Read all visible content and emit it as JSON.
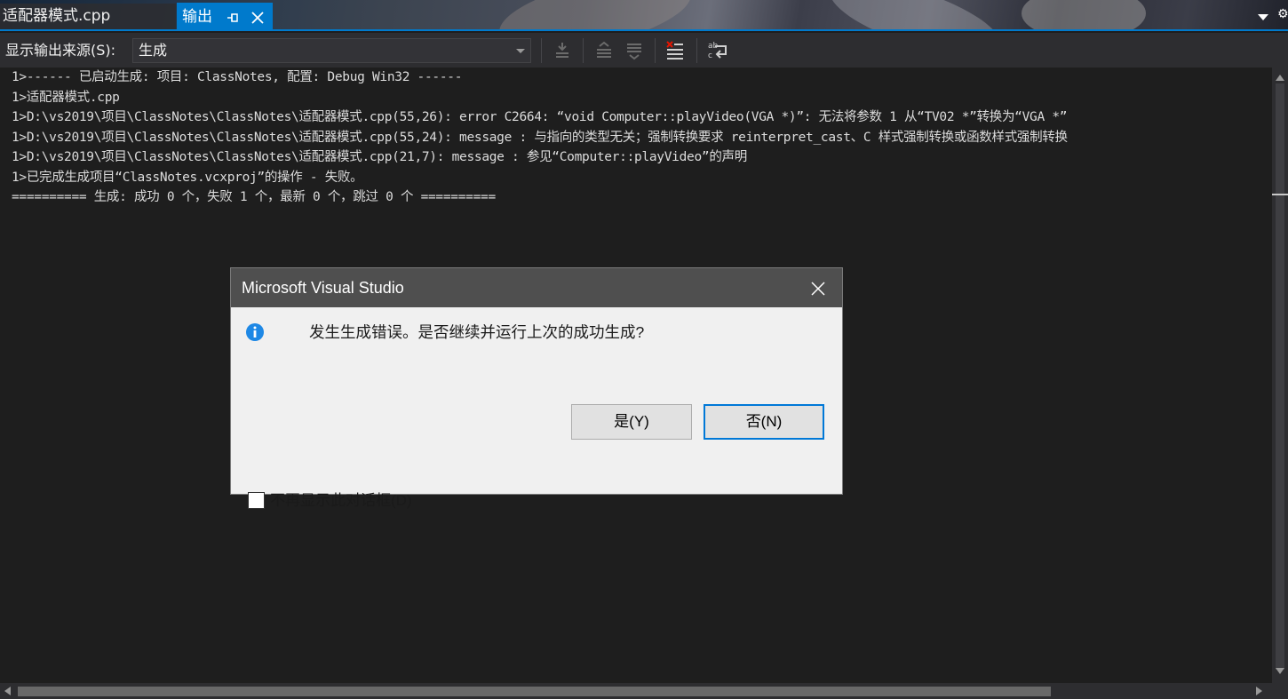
{
  "tabs": {
    "file_tab_label": "适配器模式.cpp",
    "output_tab_label": "输出"
  },
  "toolbar": {
    "source_label": "显示输出来源(S):",
    "source_value": "生成"
  },
  "output": {
    "lines": [
      "1>------ 已启动生成: 项目: ClassNotes, 配置: Debug Win32 ------",
      "1>适配器模式.cpp",
      "1>D:\\vs2019\\项目\\ClassNotes\\ClassNotes\\适配器模式.cpp(55,26): error C2664: “void Computer::playVideo(VGA *)”: 无法将参数 1 从“TV02 *”转换为“VGA *”",
      "1>D:\\vs2019\\项目\\ClassNotes\\ClassNotes\\适配器模式.cpp(55,24): message : 与指向的类型无关；强制转换要求 reinterpret_cast、C 样式强制转换或函数样式强制转换",
      "1>D:\\vs2019\\项目\\ClassNotes\\ClassNotes\\适配器模式.cpp(21,7): message : 参见“Computer::playVideo”的声明",
      "1>已完成生成项目“ClassNotes.vcxproj”的操作 - 失败。",
      "========== 生成: 成功 0 个，失败 1 个，最新 0 个，跳过 0 个 =========="
    ]
  },
  "dialog": {
    "title": "Microsoft Visual Studio",
    "message": "发生生成错误。是否继续并运行上次的成功生成?",
    "yes_label": "是(Y)",
    "no_label": "否(N)",
    "checkbox_label": "不再显示此对话框(D)",
    "checkbox_checked": false
  },
  "colors": {
    "accent": "#007acc",
    "background": "#1e1e1e",
    "text": "#dcdcdc",
    "info_icon": "#1e88e5",
    "focus_border": "#0078d7"
  },
  "icons": [
    "pin-icon",
    "close-icon",
    "chevron-down-icon",
    "settings-icon",
    "go-to-previous-message-icon",
    "go-to-next-message-icon",
    "go-to-current-message-icon",
    "clear-all-icon",
    "word-wrap-icon",
    "info-icon"
  ]
}
